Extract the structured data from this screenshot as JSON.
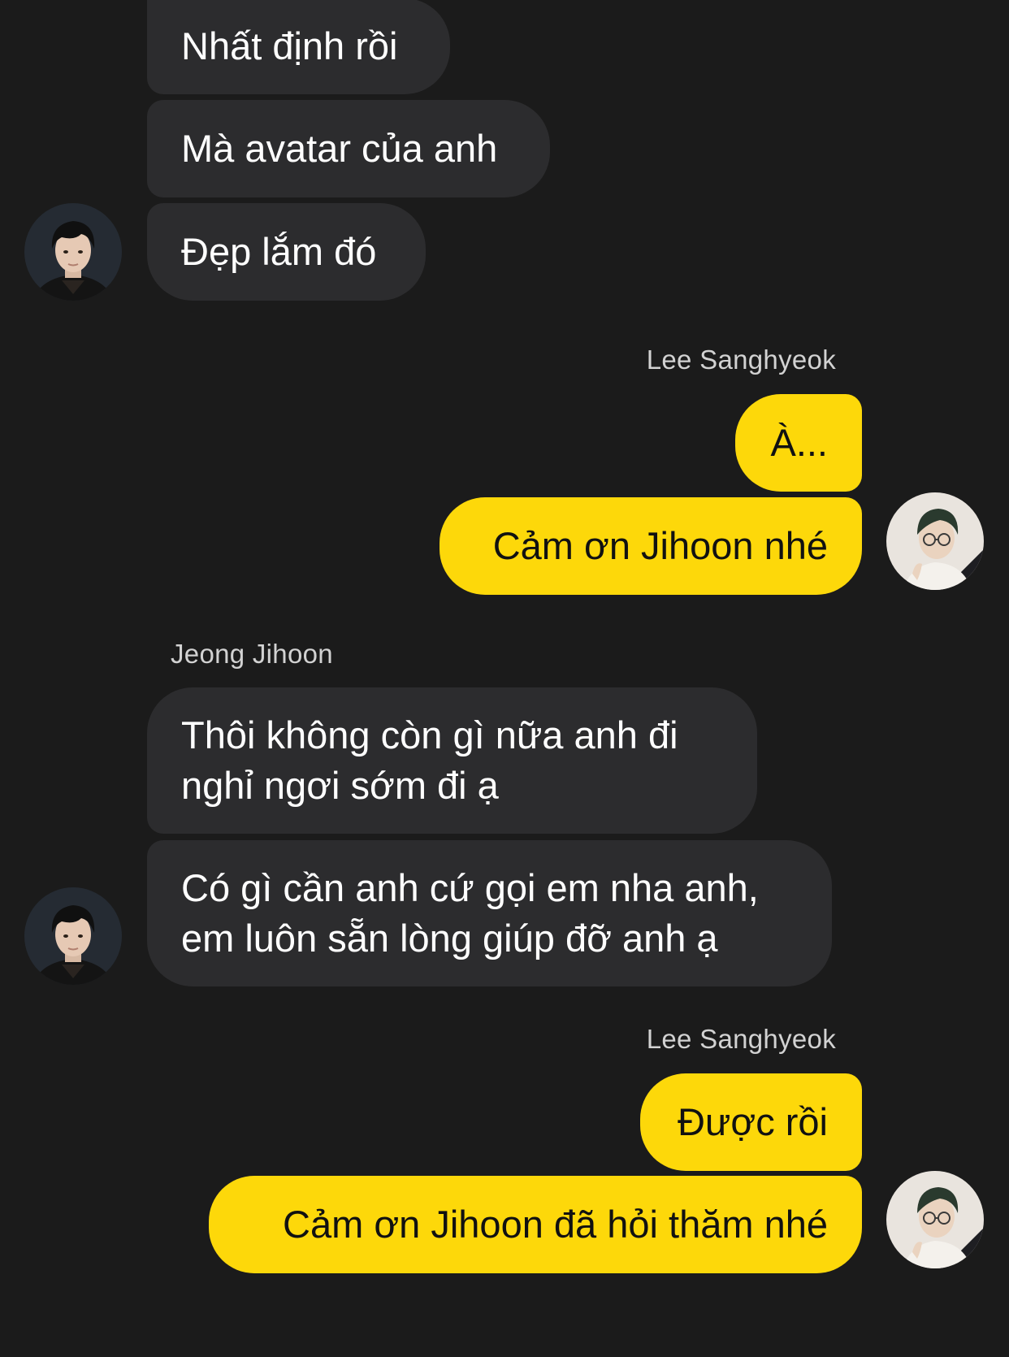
{
  "colors": {
    "background": "#1b1b1b",
    "incoming_bubble": "#2c2c2e",
    "outgoing_bubble": "#fdd80a",
    "sender_name": "#d2d2d2"
  },
  "messages": [
    {
      "direction": "incoming",
      "text": "Nhất định rồi"
    },
    {
      "direction": "incoming",
      "text": "Mà avatar của anh"
    },
    {
      "direction": "incoming",
      "text": "Đẹp lắm đó"
    },
    {
      "direction": "outgoing",
      "sender": "Lee Sanghyeok",
      "text": "À..."
    },
    {
      "direction": "outgoing",
      "text": "Cảm ơn Jihoon nhé"
    },
    {
      "direction": "incoming",
      "sender": "Jeong Jihoon",
      "text": "Thôi không còn gì nữa anh đi\nnghỉ ngơi sớm đi ạ"
    },
    {
      "direction": "incoming",
      "text": "Có gì cần anh cứ gọi em nha anh,\nem luôn sẵn lòng giúp đỡ anh ạ"
    },
    {
      "direction": "outgoing",
      "sender": "Lee Sanghyeok",
      "text": "Được rồi"
    },
    {
      "direction": "outgoing",
      "text": "Cảm ơn Jihoon đã hỏi thăm nhé"
    }
  ],
  "avatars": {
    "incoming": "jeong-jihoon-avatar",
    "outgoing": "lee-sanghyeok-avatar"
  }
}
